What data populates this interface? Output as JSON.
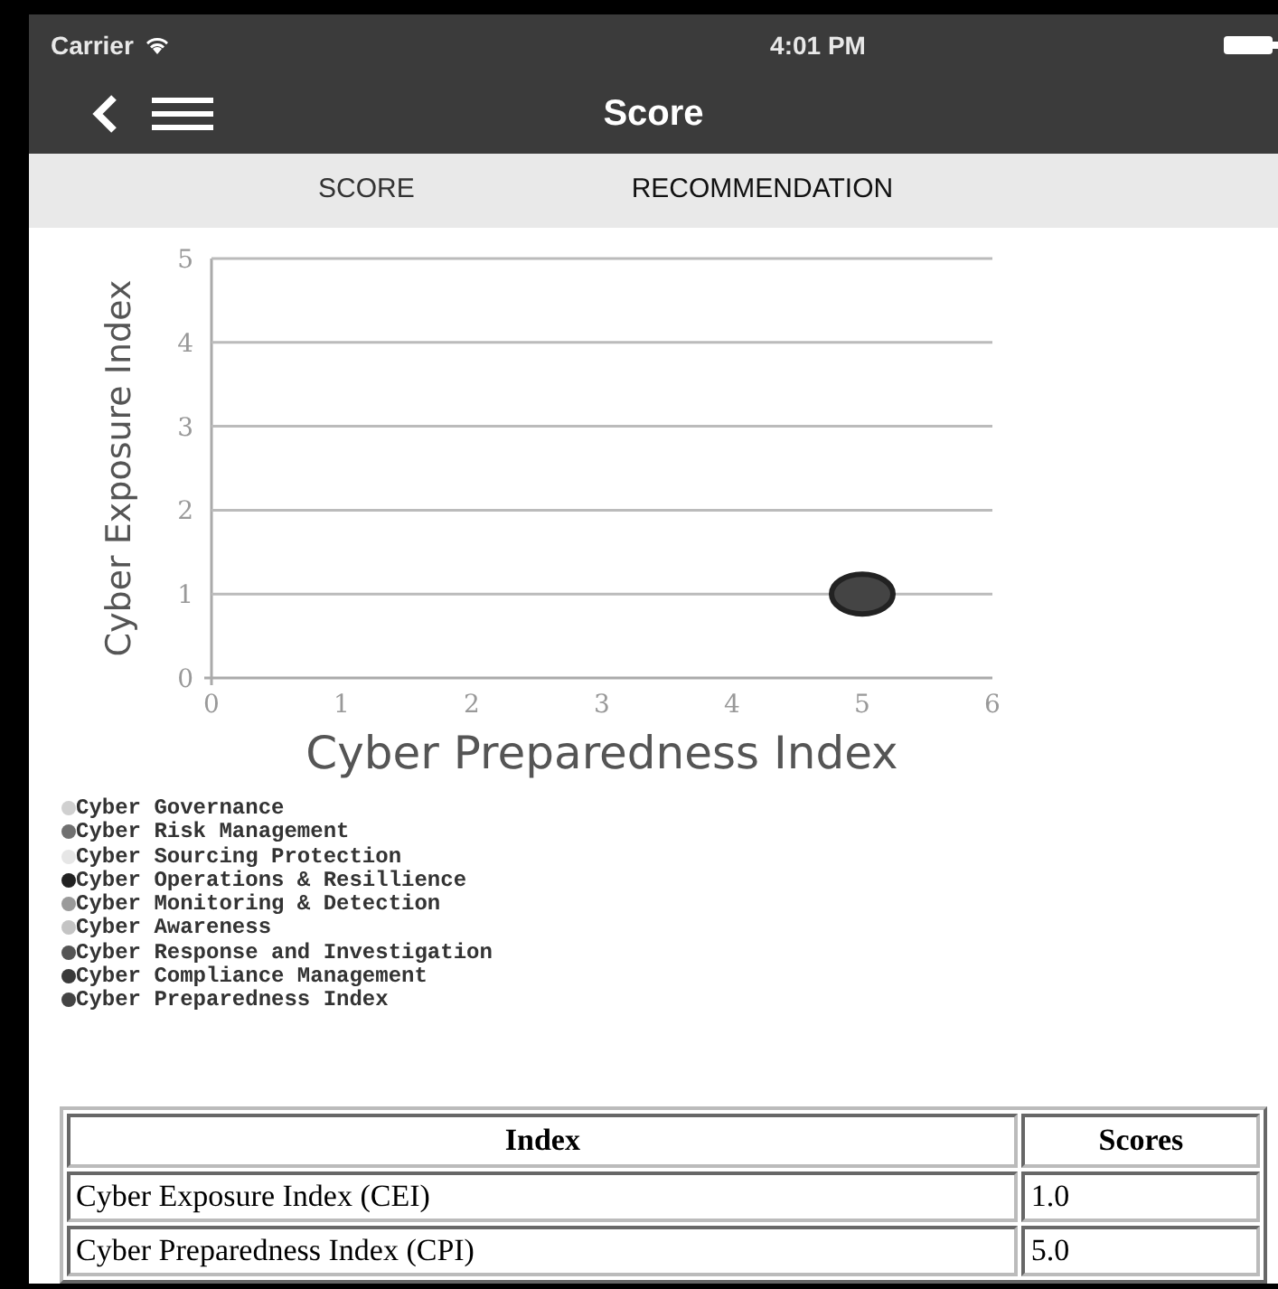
{
  "status_bar": {
    "carrier": "Carrier",
    "time": "4:01 PM"
  },
  "nav_bar": {
    "title": "Score"
  },
  "tabs": [
    {
      "label": "SCORE",
      "selected": true
    },
    {
      "label": "RECOMMENDATION",
      "selected": false
    }
  ],
  "chart": {
    "chart_data": {
      "type": "scatter",
      "xlabel": "Cyber Preparedness Index",
      "ylabel": "Cyber Exposure Index",
      "x": [
        5
      ],
      "xlim": [
        0,
        6
      ],
      "ylim": [
        0,
        5
      ],
      "xticks": [
        0,
        1,
        2,
        3,
        4,
        5,
        6
      ],
      "yticks": [
        0,
        1,
        2,
        3,
        4,
        5
      ],
      "grid": true,
      "series": [
        {
          "name": "Cyber Governance",
          "color": "#d0d0d0",
          "values": [
            null
          ]
        },
        {
          "name": "Cyber Risk Management",
          "color": "#707070",
          "values": [
            null
          ]
        },
        {
          "name": "Cyber Sourcing Protection",
          "color": "#e6e6e6",
          "values": [
            null
          ]
        },
        {
          "name": "Cyber Operations & Resillience",
          "color": "#222222",
          "values": [
            null
          ]
        },
        {
          "name": "Cyber Monitoring & Detection",
          "color": "#9a9a9a",
          "values": [
            null
          ]
        },
        {
          "name": "Cyber Awareness",
          "color": "#c4c4c4",
          "values": [
            null
          ]
        },
        {
          "name": "Cyber Response and Investigation",
          "color": "#555555",
          "values": [
            null
          ]
        },
        {
          "name": "Cyber Compliance Management",
          "color": "#3a3a3a",
          "values": [
            null
          ]
        },
        {
          "name": "Cyber Preparedness Index",
          "color": "#444444",
          "values": [
            1
          ]
        }
      ]
    }
  },
  "table": {
    "columns": [
      "Index",
      "Scores"
    ],
    "rows": [
      [
        "Cyber Exposure Index (CEI)",
        "1.0"
      ],
      [
        "Cyber Preparedness Index (CPI)",
        "5.0"
      ]
    ]
  }
}
